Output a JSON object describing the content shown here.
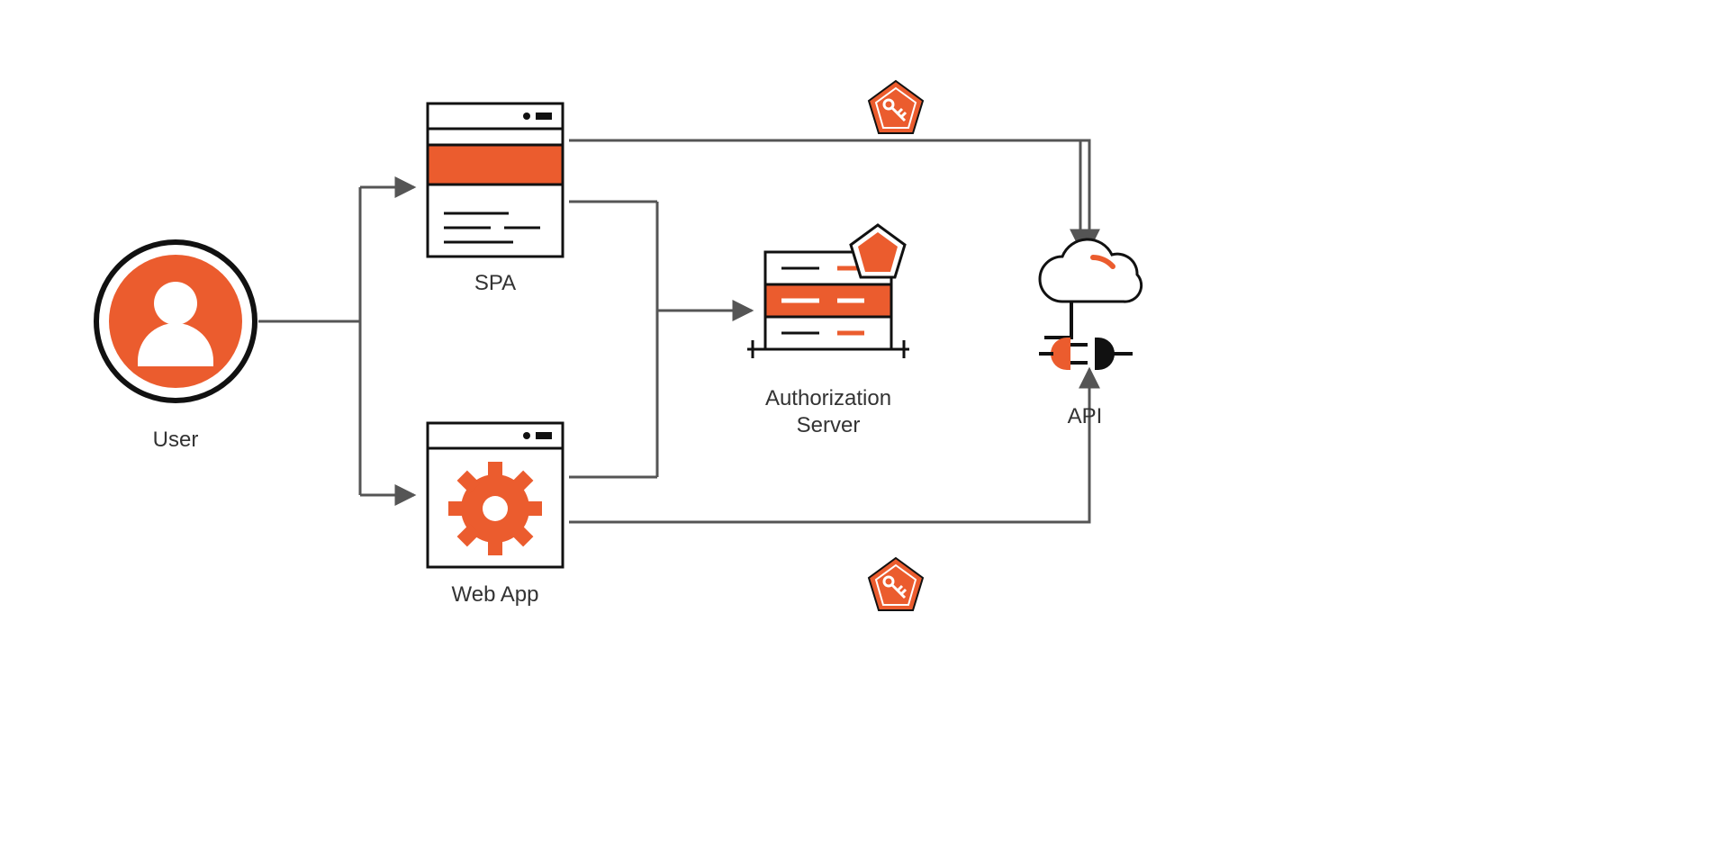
{
  "diagram": {
    "nodes": {
      "user": {
        "label": "User"
      },
      "spa": {
        "label": "SPA"
      },
      "webapp": {
        "label": "Web App"
      },
      "auth": {
        "label_line1": "Authorization",
        "label_line2": "Server"
      },
      "api": {
        "label": "API"
      }
    },
    "colors": {
      "accent": "#EB5C2E",
      "line": "#555555",
      "outline": "#111111"
    },
    "edges": [
      {
        "from": "user",
        "to": "spa",
        "token": false
      },
      {
        "from": "user",
        "to": "webapp",
        "token": false
      },
      {
        "from": "spa",
        "to": "auth",
        "token": false
      },
      {
        "from": "webapp",
        "to": "auth",
        "token": false
      },
      {
        "from": "spa",
        "to": "api",
        "token": true
      },
      {
        "from": "webapp",
        "to": "api",
        "token": true
      }
    ]
  }
}
